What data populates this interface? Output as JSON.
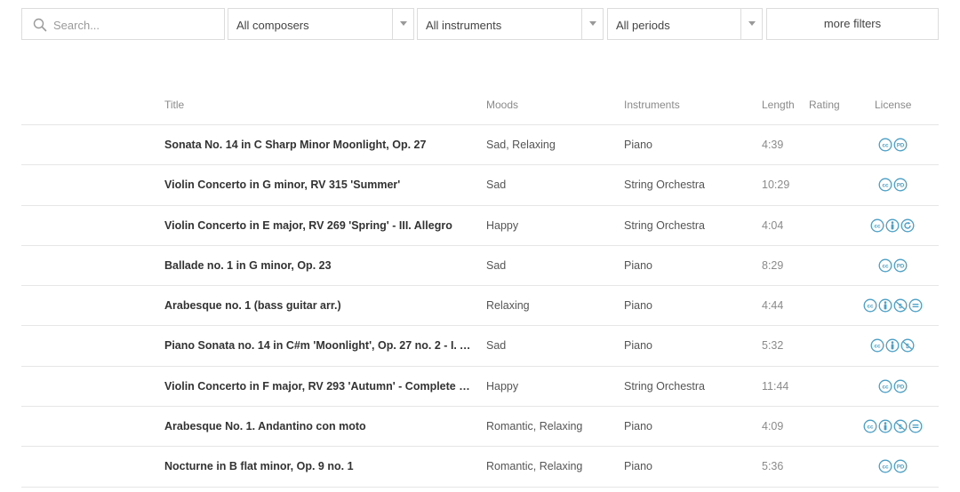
{
  "filters": {
    "search_placeholder": "Search...",
    "composer": "All composers",
    "instrument": "All instruments",
    "period": "All periods",
    "more_filters": "more filters"
  },
  "table": {
    "headers": {
      "title": "Title",
      "moods": "Moods",
      "instruments": "Instruments",
      "length": "Length",
      "rating": "Rating",
      "license": "License"
    },
    "rows": [
      {
        "title": "Sonata No. 14 in C Sharp Minor Moonlight, Op. 27",
        "moods": "Sad, Relaxing",
        "instruments": "Piano",
        "length": "4:39",
        "license": [
          "cc-icon",
          "pd-icon"
        ]
      },
      {
        "title": "Violin Concerto in G minor, RV 315 'Summer'",
        "moods": "Sad",
        "instruments": "String Orchestra",
        "length": "10:29",
        "license": [
          "cc-icon",
          "pd-icon"
        ]
      },
      {
        "title": "Violin Concerto in E major, RV 269 'Spring' - III. Allegro",
        "moods": "Happy",
        "instruments": "String Orchestra",
        "length": "4:04",
        "license": [
          "cc-icon",
          "by-icon",
          "sa-icon"
        ]
      },
      {
        "title": "Ballade no. 1 in G minor, Op. 23",
        "moods": "Sad",
        "instruments": "Piano",
        "length": "8:29",
        "license": [
          "cc-icon",
          "pd-icon"
        ]
      },
      {
        "title": "Arabesque no. 1 (bass guitar arr.)",
        "moods": "Relaxing",
        "instruments": "Piano",
        "length": "4:44",
        "license": [
          "cc-icon",
          "by-icon",
          "nc-icon",
          "nd-icon"
        ]
      },
      {
        "title": "Piano Sonata no. 14 in C#m 'Moonlight', Op. 27 no. 2 - I. Ada...",
        "moods": "Sad",
        "instruments": "Piano",
        "length": "5:32",
        "license": [
          "cc-icon",
          "by-icon",
          "nc-icon"
        ]
      },
      {
        "title": "Violin Concerto in F major, RV 293 'Autumn' - Complete Con...",
        "moods": "Happy",
        "instruments": "String Orchestra",
        "length": "11:44",
        "license": [
          "cc-icon",
          "pd-icon"
        ]
      },
      {
        "title": "Arabesque No. 1. Andantino con moto",
        "moods": "Romantic, Relaxing",
        "instruments": "Piano",
        "length": "4:09",
        "license": [
          "cc-icon",
          "by-icon",
          "nc-icon",
          "nd-icon"
        ]
      },
      {
        "title": "Nocturne in B flat minor, Op. 9 no. 1",
        "moods": "Romantic, Relaxing",
        "instruments": "Piano",
        "length": "5:36",
        "license": [
          "cc-icon",
          "pd-icon"
        ]
      }
    ]
  },
  "colors": {
    "license_icon": "#4a9fc7",
    "border": "#dcdcdc"
  }
}
